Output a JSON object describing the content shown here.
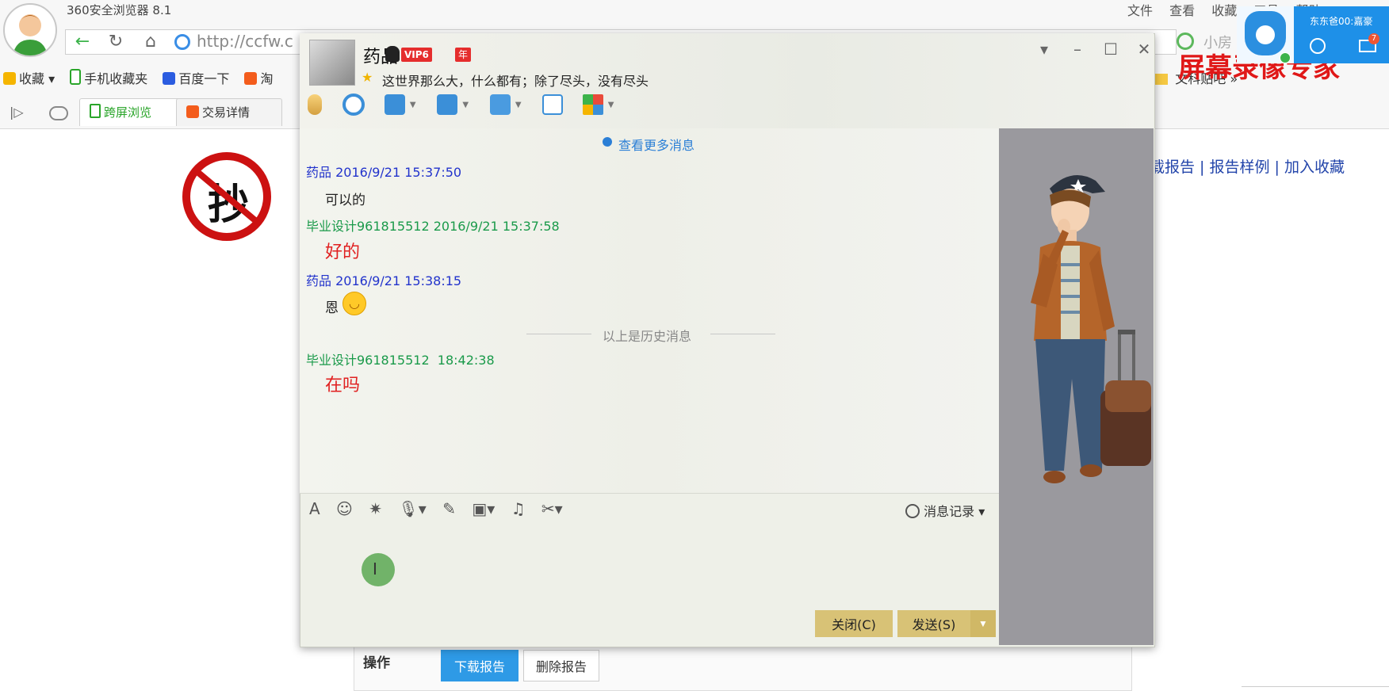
{
  "browser": {
    "title": "360安全浏览器 8.1",
    "menu": [
      "文件",
      "查看",
      "收藏",
      "工具",
      "帮助"
    ],
    "url": "http://ccfw.c",
    "search_placeholder": "小房",
    "bookmarks": [
      "收藏",
      "手机收藏夹",
      "百度一下",
      "淘"
    ],
    "bookmarks_right": [
      "吧",
      "文科贴吧",
      "»"
    ],
    "tabs": [
      {
        "label": "跨屏浏览"
      },
      {
        "label": "交易详情"
      }
    ],
    "overlay_text": "屏幕录像专家"
  },
  "page": {
    "stamp_char": "抄",
    "links": "载报告 | 报告样例 | 加入收藏",
    "ops_label": "操作",
    "download_label": "下载报告",
    "delete_label": "删除报告"
  },
  "notify": {
    "text": "东东爸00:嘉豪",
    "badge": "7"
  },
  "qq": {
    "name": "药品",
    "vip": "VIP6",
    "year": "年",
    "signature": "这世界那么大，什么都有；除了尽头，没有尽头",
    "more_messages": "查看更多消息",
    "history_divider": "以上是历史消息",
    "message_record": "消息记录",
    "close_label": "关闭(C)",
    "send_label": "发送(S)",
    "messages": [
      {
        "sender": "药品",
        "time": "2016/9/21 15:37:50",
        "text": "可以的"
      },
      {
        "sender": "毕业设计961815512",
        "time": "2016/9/21 15:37:58",
        "text": "好的"
      },
      {
        "sender": "药品",
        "time": "2016/9/21 15:38:15",
        "text": "恩"
      },
      {
        "sender": "毕业设计961815512",
        "time": "18:42:38",
        "text": "在吗"
      }
    ]
  },
  "colors": {
    "accent": "#2e9ae6",
    "qq_button": "#d8c276",
    "self_name": "#2233cc",
    "other_name": "#1a9a4a",
    "red_text": "#e02020"
  }
}
